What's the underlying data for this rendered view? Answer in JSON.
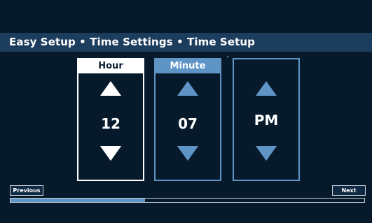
{
  "header": {
    "title": "Easy Setup • Time Settings • Time Setup"
  },
  "hour": {
    "label": "Hour",
    "value": "12"
  },
  "minute": {
    "label": "Minute",
    "value": "07"
  },
  "ampm": {
    "value": "PM"
  },
  "footer": {
    "previous_label": "Previous",
    "next_label": "Next",
    "progress_fraction": 0.38
  },
  "colors": {
    "background": "#071a2c",
    "title_bar": "#1c3d5e",
    "accent": "#5f95c6",
    "text": "#ffffff"
  },
  "icons": [
    "up-arrow-icon",
    "down-arrow-icon"
  ]
}
